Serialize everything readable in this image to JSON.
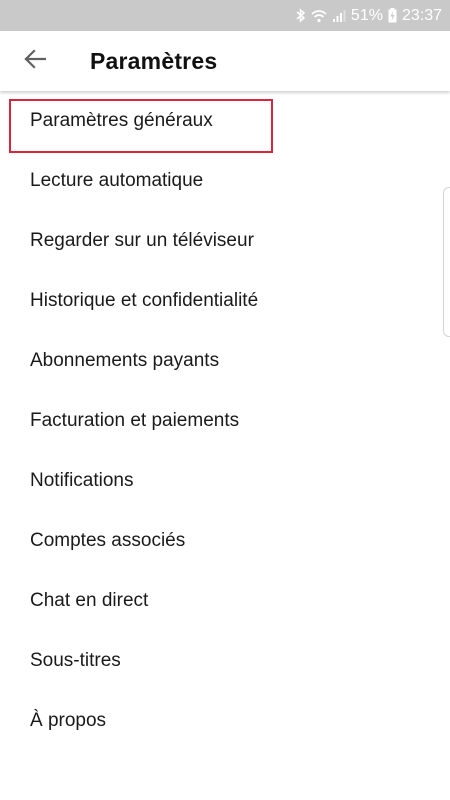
{
  "status_bar": {
    "battery": "51%",
    "time": "23:37",
    "icons": [
      "bluetooth-icon",
      "wifi-icon",
      "signal-icon",
      "battery-charging-icon"
    ]
  },
  "header": {
    "back_icon": "arrow-left-icon",
    "title": "Paramètres"
  },
  "settings": {
    "items": [
      {
        "label": "Paramètres généraux",
        "highlighted": true
      },
      {
        "label": "Lecture automatique"
      },
      {
        "label": "Regarder sur un téléviseur"
      },
      {
        "label": "Historique et confidentialité"
      },
      {
        "label": "Abonnements payants"
      },
      {
        "label": "Facturation et paiements"
      },
      {
        "label": "Notifications"
      },
      {
        "label": "Comptes associés"
      },
      {
        "label": "Chat en direct"
      },
      {
        "label": "Sous-titres"
      },
      {
        "label": "À propos"
      }
    ]
  },
  "colors": {
    "highlight": "#d7263d",
    "status_bar_bg": "#c9c9c9"
  }
}
